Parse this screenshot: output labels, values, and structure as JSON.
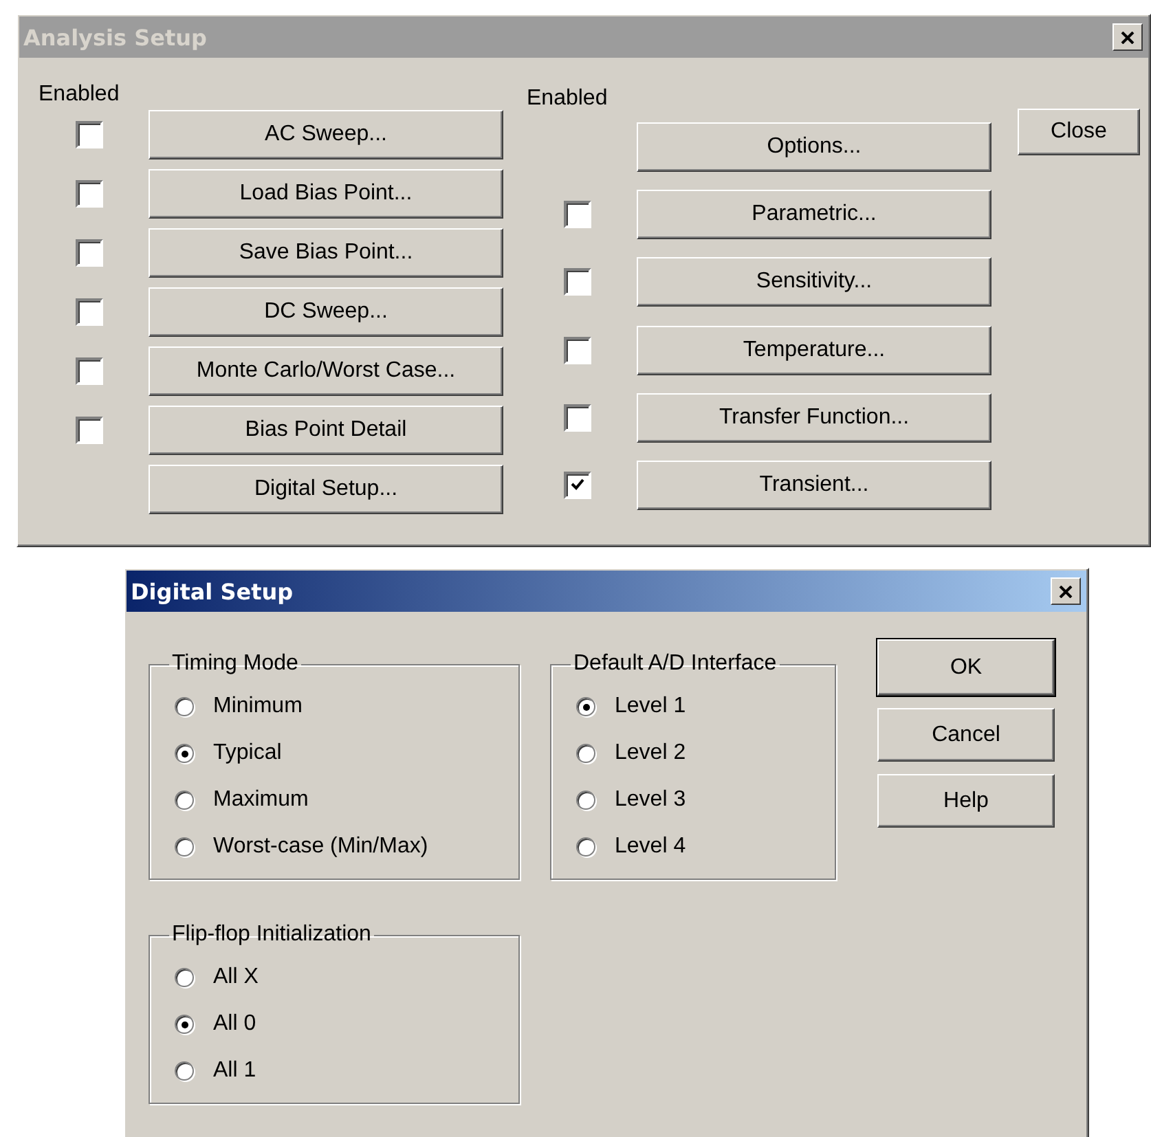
{
  "analysis_setup": {
    "title": "Analysis Setup",
    "left_column": {
      "header": "Enabled",
      "rows": [
        {
          "label": "AC Sweep...",
          "kind": "check",
          "checked": false
        },
        {
          "label": "Load Bias Point...",
          "kind": "check",
          "checked": false
        },
        {
          "label": "Save Bias Point...",
          "kind": "check",
          "checked": false
        },
        {
          "label": "DC Sweep...",
          "kind": "check",
          "checked": false
        },
        {
          "label": "Monte Carlo/Worst Case...",
          "kind": "check",
          "checked": false
        },
        {
          "label": "Bias Point Detail",
          "kind": "check",
          "checked": false
        },
        {
          "label": "Digital Setup...",
          "kind": "plain"
        }
      ]
    },
    "right_column": {
      "header": "Enabled",
      "rows": [
        {
          "label": "Options...",
          "kind": "plain"
        },
        {
          "label": "Parametric...",
          "kind": "check",
          "checked": false
        },
        {
          "label": "Sensitivity...",
          "kind": "check",
          "checked": false
        },
        {
          "label": "Temperature...",
          "kind": "check",
          "checked": false
        },
        {
          "label": "Transfer Function...",
          "kind": "check",
          "checked": false
        },
        {
          "label": "Transient...",
          "kind": "check",
          "checked": true
        }
      ]
    },
    "close_button": "Close"
  },
  "digital_setup": {
    "title": "Digital Setup",
    "groups": [
      {
        "title": "Timing Mode",
        "options": [
          {
            "label": "Minimum",
            "selected": false
          },
          {
            "label": "Typical",
            "selected": true
          },
          {
            "label": "Maximum",
            "selected": false
          },
          {
            "label": "Worst-case (Min/Max)",
            "selected": false
          }
        ]
      },
      {
        "title": "Default A/D Interface",
        "options": [
          {
            "label": "Level 1",
            "selected": true
          },
          {
            "label": "Level 2",
            "selected": false
          },
          {
            "label": "Level 3",
            "selected": false
          },
          {
            "label": "Level 4",
            "selected": false
          }
        ]
      },
      {
        "title": "Flip-flop Initialization",
        "options": [
          {
            "label": "All X",
            "selected": false
          },
          {
            "label": "All 0",
            "selected": true
          },
          {
            "label": "All 1",
            "selected": false
          }
        ]
      }
    ],
    "buttons": [
      {
        "label": "OK",
        "default": true
      },
      {
        "label": "Cancel",
        "default": false
      },
      {
        "label": "Help",
        "default": false
      }
    ]
  }
}
